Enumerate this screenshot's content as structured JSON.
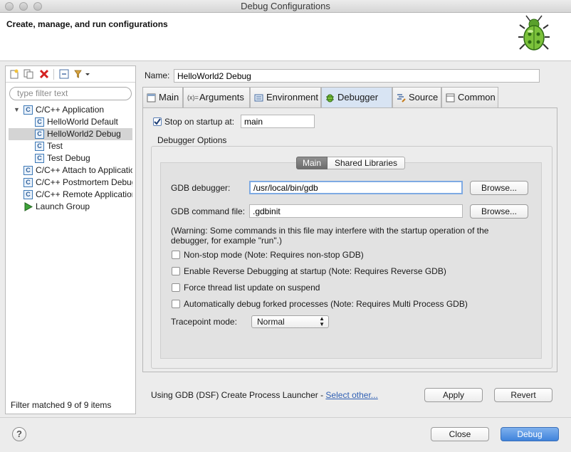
{
  "window": {
    "title": "Debug Configurations"
  },
  "header": {
    "title": "Create, manage, and run configurations"
  },
  "left": {
    "filter_placeholder": "type filter text",
    "tree": [
      {
        "label": "C/C++ Application",
        "level": 0,
        "expanded": true
      },
      {
        "label": "HelloWorld Default",
        "level": 1
      },
      {
        "label": "HelloWorld2 Debug",
        "level": 1,
        "selected": true
      },
      {
        "label": "Test",
        "level": 1
      },
      {
        "label": "Test Debug",
        "level": 1
      },
      {
        "label": "C/C++ Attach to Application",
        "level": 0
      },
      {
        "label": "C/C++ Postmortem Debugger",
        "level": 0
      },
      {
        "label": "C/C++ Remote Application",
        "level": 0
      },
      {
        "label": "Launch Group",
        "level": 0
      }
    ],
    "filter_status": "Filter matched 9 of 9 items"
  },
  "config": {
    "name_label": "Name:",
    "name_value": "HelloWorld2 Debug",
    "tabs": [
      "Main",
      "Arguments",
      "Environment",
      "Debugger",
      "Source",
      "Common"
    ],
    "active_tab": "Debugger"
  },
  "debugger": {
    "stop_on_startup_label": "Stop on startup at:",
    "stop_on_startup_checked": true,
    "stop_on_startup_value": "main",
    "options_title": "Debugger Options",
    "subtabs": [
      "Main",
      "Shared Libraries"
    ],
    "active_subtab": "Main",
    "gdb_debugger_label": "GDB debugger:",
    "gdb_debugger_value": "/usr/local/bin/gdb",
    "gdb_command_file_label": "GDB command file:",
    "gdb_command_file_value": ".gdbinit",
    "browse_label": "Browse...",
    "warning_line1": "(Warning: Some commands in this file may interfere with the startup operation of the",
    "warning_line2": "debugger, for example \"run\".)",
    "options": [
      {
        "label": "Non-stop mode (Note: Requires non-stop GDB)",
        "checked": false
      },
      {
        "label": "Enable Reverse Debugging at startup (Note: Requires Reverse GDB)",
        "checked": false
      },
      {
        "label": "Force thread list update on suspend",
        "checked": false
      },
      {
        "label": "Automatically debug forked processes (Note: Requires Multi Process GDB)",
        "checked": false
      }
    ],
    "tracepoint_label": "Tracepoint mode:",
    "tracepoint_value": "Normal"
  },
  "footer": {
    "launcher_text": "Using GDB (DSF) Create Process Launcher - ",
    "select_other": "Select other...",
    "apply": "Apply",
    "revert": "Revert",
    "close": "Close",
    "debug": "Debug",
    "help": "?"
  },
  "colors": {
    "accent": "#3f83db",
    "tab_active": "#d8e4f3",
    "link": "#2f5fb3"
  }
}
